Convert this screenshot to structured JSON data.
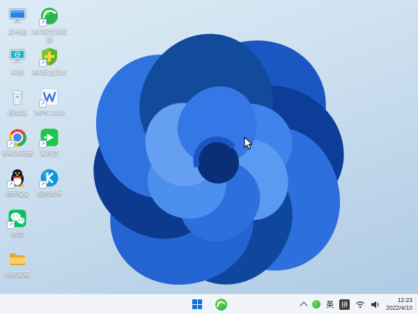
{
  "colors": {
    "wallpaper_top": "#dcebf6",
    "wallpaper_bottom": "#adc9e4",
    "bloom_dark_blue": "#0b3a8f",
    "bloom_light_blue": "#5a9af2",
    "taskbar_bg": "#f1f5fa",
    "start_blue": "#1470df"
  },
  "desktop": {
    "icons": [
      {
        "name": "this-pc",
        "label": "此电脑",
        "shortcut": false
      },
      {
        "name": "360-browser",
        "label": "360安全浏览器",
        "shortcut": true
      },
      {
        "name": "network",
        "label": "网络",
        "shortcut": false
      },
      {
        "name": "360-safe",
        "label": "360安全卫士",
        "shortcut": true
      },
      {
        "name": "recycle-bin",
        "label": "回收站",
        "shortcut": false
      },
      {
        "name": "wps-2019",
        "label": "WPS 2019",
        "shortcut": true
      },
      {
        "name": "chrome",
        "label": "谷歌浏览器",
        "shortcut": true
      },
      {
        "name": "iqiyi",
        "label": "爱奇艺",
        "shortcut": true
      },
      {
        "name": "qq",
        "label": "腾讯QQ",
        "shortcut": true
      },
      {
        "name": "kugou",
        "label": "酷狗音乐",
        "shortcut": true
      },
      {
        "name": "wechat",
        "label": "微信",
        "shortcut": true
      },
      {
        "name": "install-folder",
        "label": "系统安装",
        "shortcut": false
      }
    ]
  },
  "taskbar": {
    "center_icons": [
      "windows-start",
      "360-browser"
    ],
    "tray": {
      "icons": [
        "chevron-up",
        "360-tray",
        "ime-language",
        "ime-pinyin",
        "network",
        "volume"
      ],
      "ime_lang": "英",
      "ime_mode": "拼",
      "time": "12:23",
      "date": "2022/4/10"
    }
  }
}
